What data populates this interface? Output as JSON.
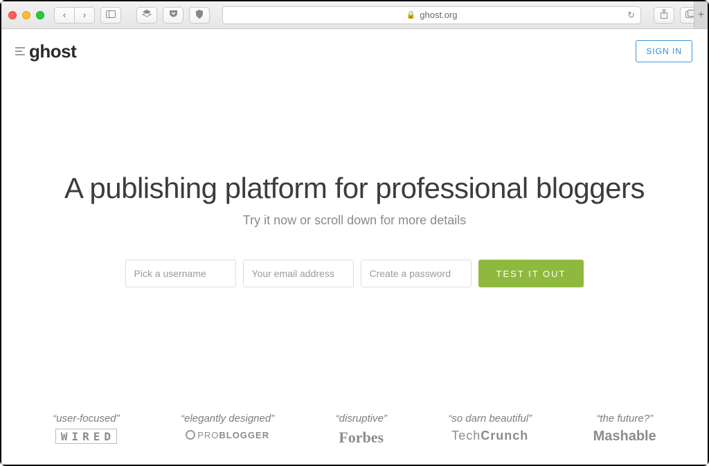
{
  "browser": {
    "url_display": "ghost.org"
  },
  "header": {
    "brand": "ghost",
    "signin_label": "SIGN IN"
  },
  "hero": {
    "title": "A publishing platform for professional bloggers",
    "subtitle": "Try it now or scroll down for more details"
  },
  "signup": {
    "username_placeholder": "Pick a username",
    "email_placeholder": "Your email address",
    "password_placeholder": "Create a password",
    "cta_label": "TEST IT OUT"
  },
  "press": [
    {
      "quote": "“user-focused”",
      "source": "WIRED"
    },
    {
      "quote": "“elegantly designed”",
      "source": "PROBLOGGER"
    },
    {
      "quote": "“disruptive”",
      "source": "Forbes"
    },
    {
      "quote": "“so darn beautiful”",
      "source": "TechCrunch"
    },
    {
      "quote": "“the future?”",
      "source": "Mashable"
    }
  ]
}
